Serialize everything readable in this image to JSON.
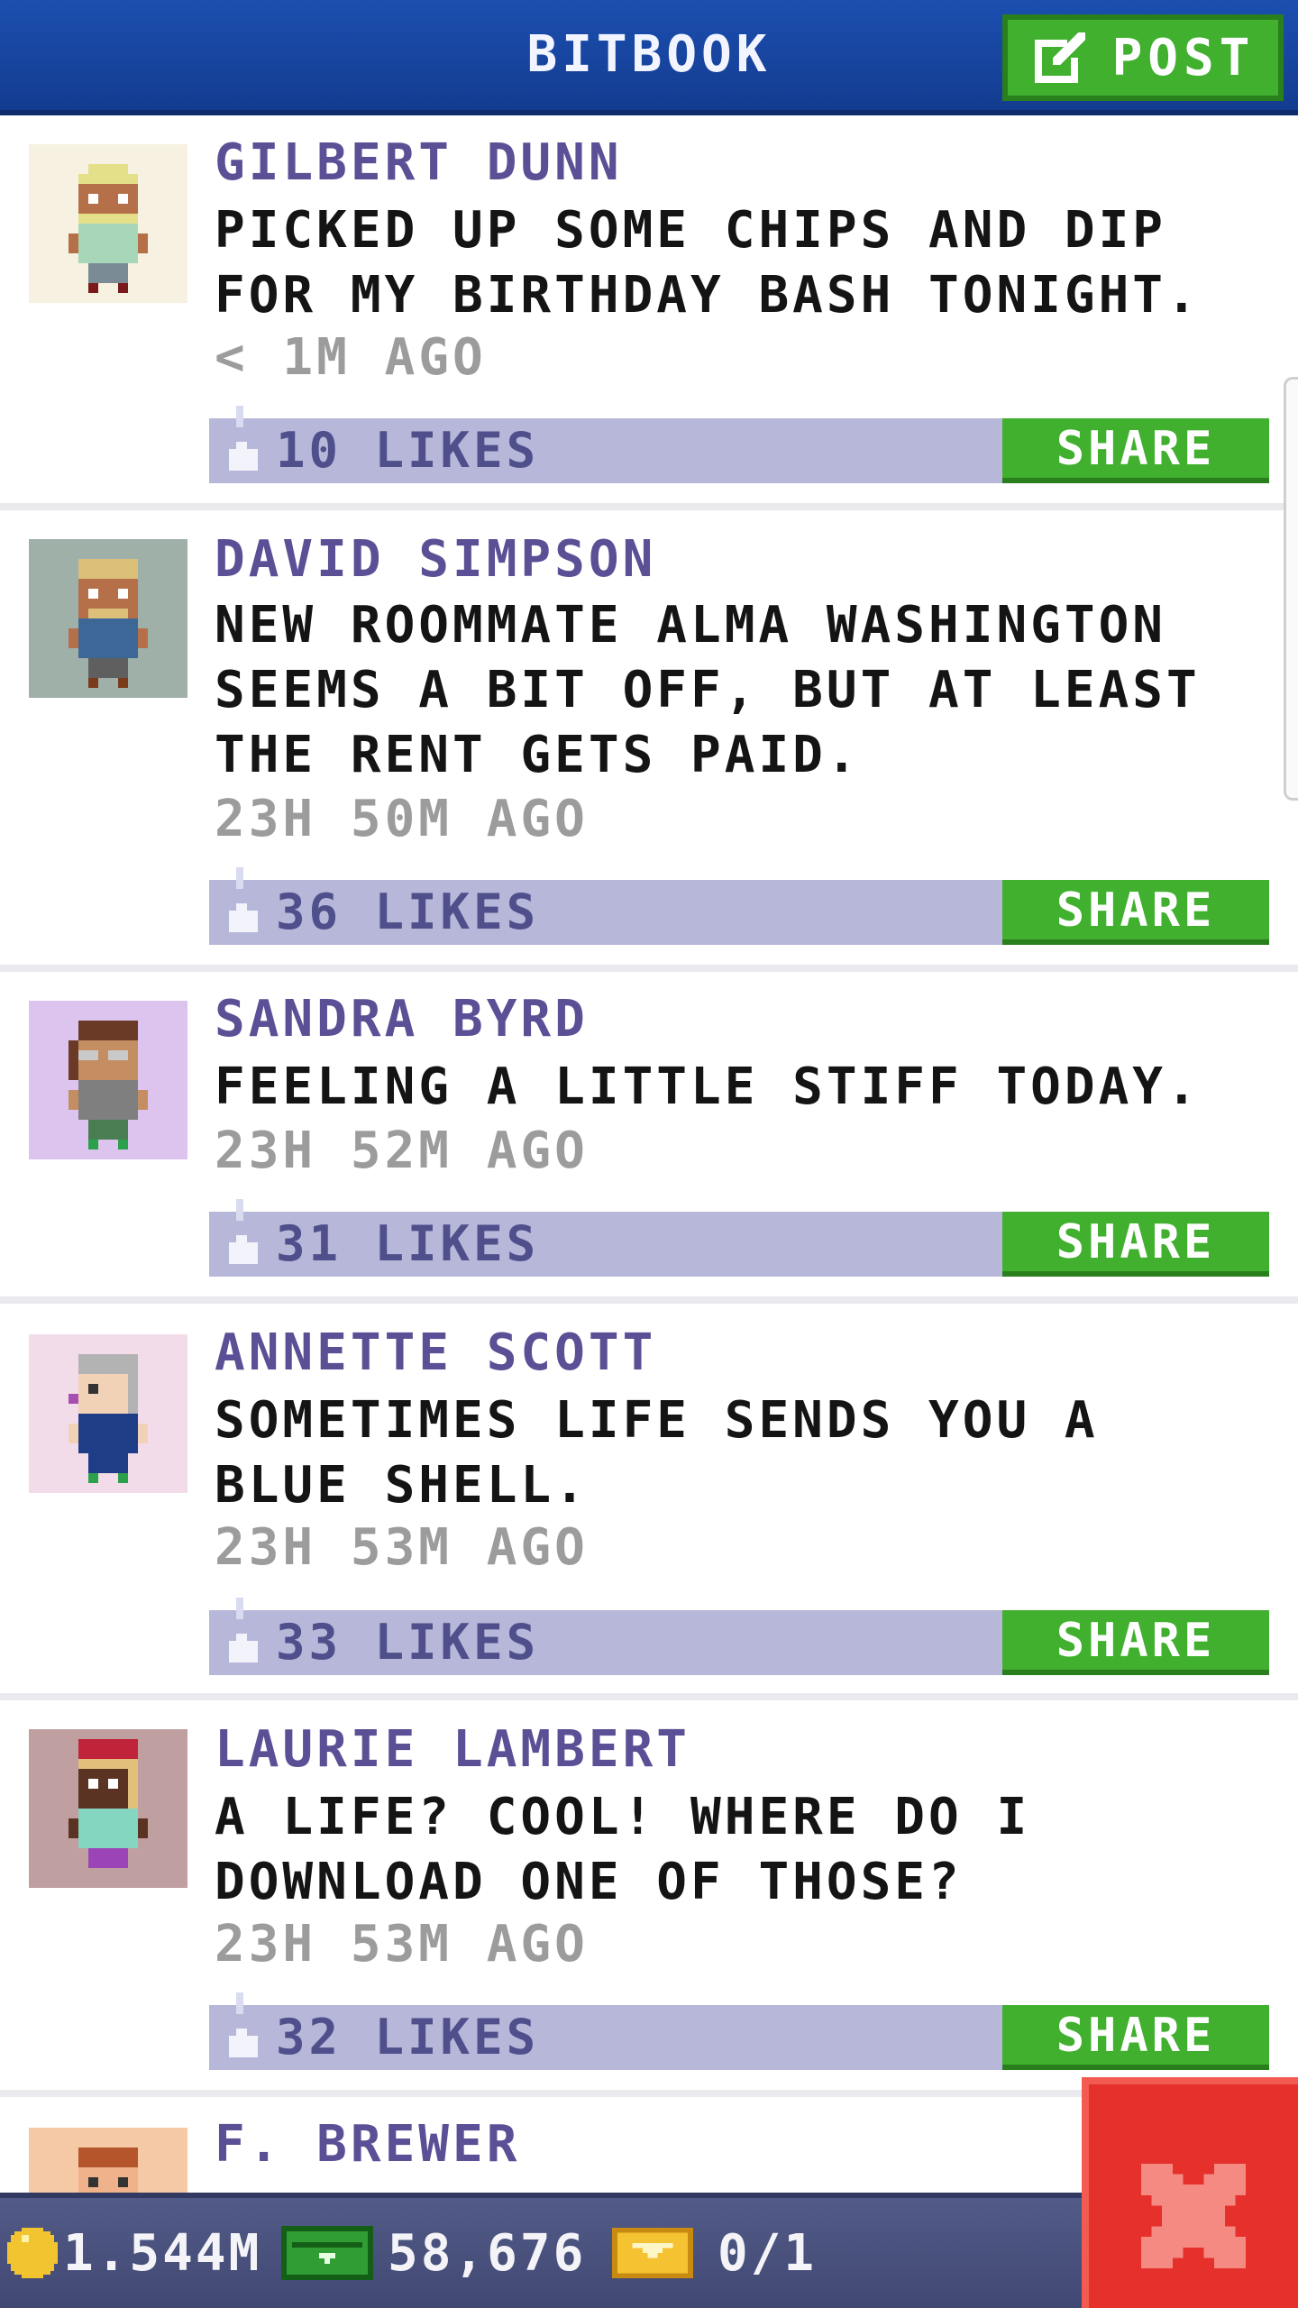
{
  "header": {
    "title": "BITBOOK",
    "post_label": "POST"
  },
  "posts": [
    {
      "author": "GILBERT DUNN",
      "text": "PICKED UP SOME CHIPS AND DIP FOR MY BIRTHDAY BASH TONIGHT.",
      "time": "< 1M AGO",
      "likes": "10 LIKES",
      "share_label": "SHARE"
    },
    {
      "author": "DAVID SIMPSON",
      "text": "NEW ROOMMATE ALMA WASHINGTON SEEMS A BIT OFF, BUT AT LEAST THE RENT GETS PAID.",
      "time": "23H 50M AGO",
      "likes": "36 LIKES",
      "share_label": "SHARE"
    },
    {
      "author": "SANDRA BYRD",
      "text": "FEELING A LITTLE STIFF TODAY.",
      "time": "23H 52M AGO",
      "likes": "31 LIKES",
      "share_label": "SHARE"
    },
    {
      "author": "ANNETTE SCOTT",
      "text": "SOMETIMES LIFE SENDS YOU A BLUE SHELL.",
      "time": "23H 53M AGO",
      "likes": "33 LIKES",
      "share_label": "SHARE"
    },
    {
      "author": "LAURIE LAMBERT",
      "text": "A LIFE? COOL! WHERE DO I DOWNLOAD ONE OF THOSE?",
      "time": "23H 53M AGO",
      "likes": "32 LIKES",
      "share_label": "SHARE"
    },
    {
      "author": "F. BREWER"
    }
  ],
  "stats": {
    "coins": "1.544M",
    "bux": "58,676",
    "tickets": "0/1"
  },
  "icons": [
    "edit-icon",
    "thumbs-up-icon",
    "coin-icon",
    "bux-icon",
    "ticket-icon",
    "close-icon"
  ],
  "colors": {
    "header": "#1c4fb0",
    "accent_green": "#40b02e",
    "like_bar": "#b6b7d9",
    "author_text": "#5b4f95",
    "close_red": "#e5302b"
  }
}
